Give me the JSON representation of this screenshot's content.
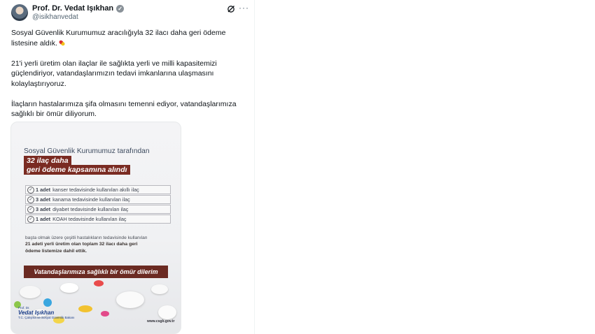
{
  "author": {
    "name": "Prof. Dr. Vedat Işıkhan",
    "handle": "@isikhanvedat"
  },
  "icons": {
    "verified": "verified-badge-icon",
    "grok": "grok-icon",
    "more": "more-options-icon",
    "pill_emoji": "pill-emoji-icon"
  },
  "tweet": {
    "p1": "Sosyal Güvenlik Kurumumuz aracılığıyla 32 ilacı daha geri ödeme listesine aldık.",
    "p2": "21'i yerli üretim olan ilaçlar ile sağlıkta yerli ve milli kapasitemizi güçlendiriyor, vatandaşlarımızın tedavi imkanlarına ulaşmasını kolaylaştırıyoruz.",
    "p3": "İlaçların hastalarımıza şifa olmasını temenni ediyor, vatandaşlarımıza sağlıklı bir ömür diliyorum."
  },
  "card": {
    "heading": "Sosyal Güvenlik Kurumumuz tarafından",
    "highlight_line1": "32 ilaç daha",
    "highlight_line2": "geri ödeme kapsamına alındı",
    "items": [
      {
        "count": "1 adet",
        "text": "kanser tedavisinde kullanılan akıllı ilaç"
      },
      {
        "count": "3 adet",
        "text": "kanama tedavisinde kullanılan ilaç"
      },
      {
        "count": "3 adet",
        "text": "diyabet tedavisinde kullanılan ilaç"
      },
      {
        "count": "1 adet",
        "text": "KOAH tedavisinde kullanılan ilaç"
      }
    ],
    "paragraph": "başta olmak üzere çeşitli hastalıkların tedavisinde kullanılan",
    "paragraph_bold": "21 adeti yerli üretim olan toplam 32 ilacı daha geri ödeme listemize dahil ettik.",
    "banner": "Vatandaşlarımıza sağlıklı bir ömür dilerim",
    "logo_prefix": "Prof. Dr.",
    "logo_name": "Vedat Işıkhan",
    "logo_sub": "T.C. Çalışma ve Sosyal Güvenlik Bakanı",
    "site": "www.csgb.gov.tr"
  }
}
